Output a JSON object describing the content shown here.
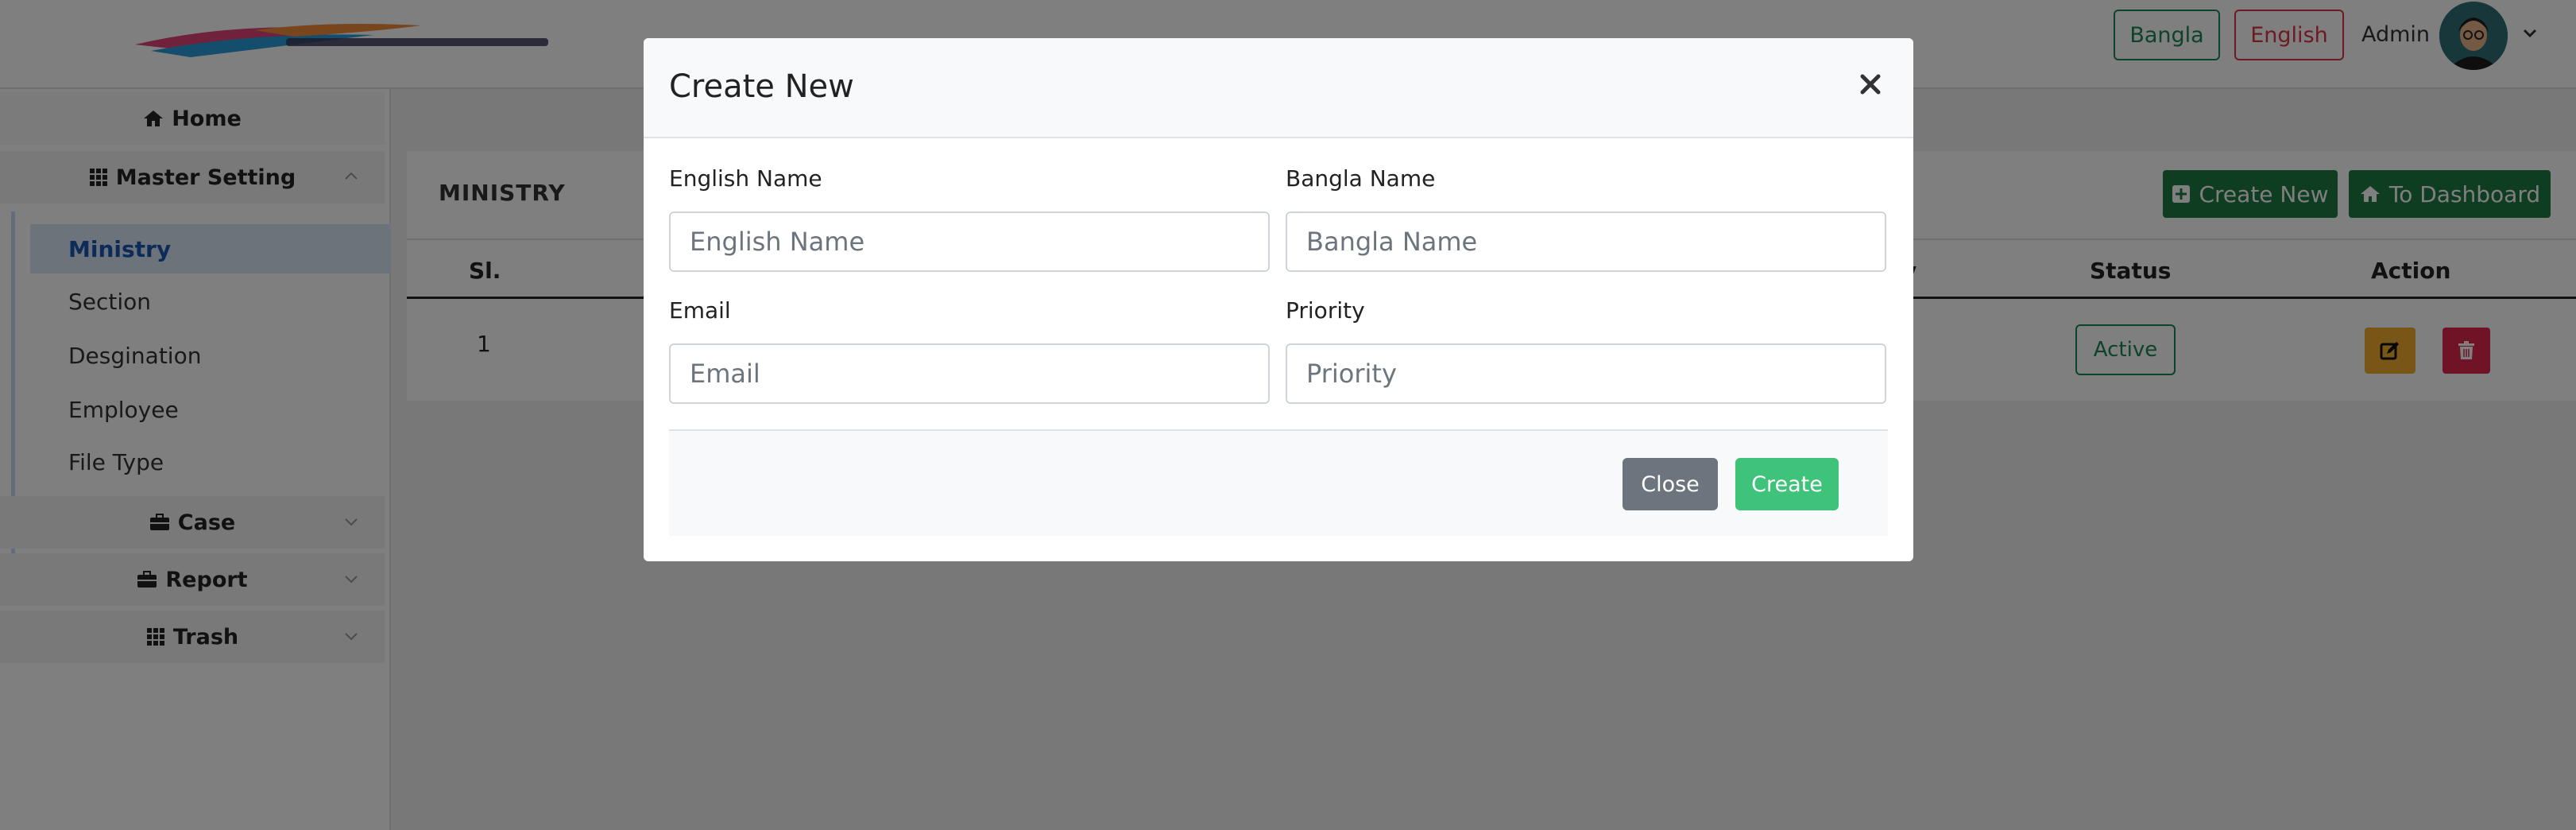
{
  "header": {
    "lang_bangla": "Bangla",
    "lang_english": "English",
    "admin_name": "Admin"
  },
  "sidebar": {
    "home": "Home",
    "master_setting": "Master Setting",
    "sub_items": [
      "Ministry",
      "Section",
      "Desgination",
      "Employee",
      "File Type"
    ],
    "case": "Case",
    "report": "Report",
    "trash": "Trash"
  },
  "page": {
    "title": "MINISTRY",
    "create_new": "Create New",
    "to_dashboard": "To Dashboard",
    "columns": {
      "sl": "Sl.",
      "priority_partial": "y",
      "status": "Status",
      "action": "Action"
    },
    "rows": [
      {
        "sl": "1",
        "status": "Active"
      }
    ]
  },
  "modal": {
    "title": "Create New",
    "english_name_label": "English Name",
    "english_name_placeholder": "English Name",
    "bangla_name_label": "Bangla Name",
    "bangla_name_placeholder": "Bangla Name",
    "email_label": "Email",
    "email_placeholder": "Email",
    "priority_label": "Priority",
    "priority_placeholder": "Priority",
    "close_label": "Close",
    "create_label": "Create"
  },
  "colors": {
    "success": "#198754",
    "danger": "#dc3545",
    "primary_dark_green": "#1f7a43",
    "create_green": "#3fc279",
    "secondary": "#6c757d",
    "warning": "#f0ad2e",
    "active_link": "#1a56b0"
  },
  "icons": {
    "home": "home-icon",
    "grid": "grid-icon",
    "briefcase": "briefcase-icon",
    "plus_square": "plus-square-icon",
    "edit": "edit-icon",
    "trash": "trash-icon",
    "close": "close-icon",
    "chevron": "chevron-down-icon"
  }
}
